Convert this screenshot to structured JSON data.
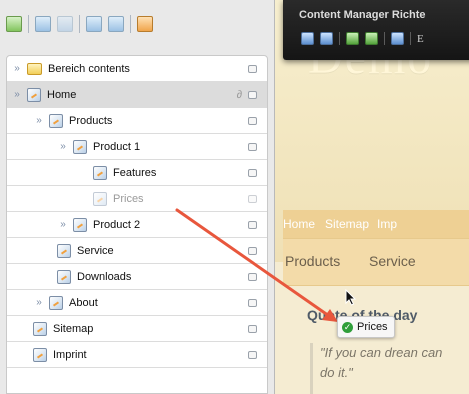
{
  "toolbar": {
    "icons": [
      "new-page-icon",
      "copy-icon",
      "paste-icon",
      "window-icon",
      "panels-icon",
      "export-icon"
    ]
  },
  "tree": {
    "items": [
      {
        "label": "Bereich contents",
        "expanded": true
      },
      {
        "label": "Home",
        "expanded": true
      },
      {
        "label": "Products",
        "expanded": true
      },
      {
        "label": "Product 1",
        "expanded": true
      },
      {
        "label": "Features"
      },
      {
        "label": "Prices",
        "dragging": true
      },
      {
        "label": "Product 2",
        "collapsed": true
      },
      {
        "label": "Service"
      },
      {
        "label": "Downloads"
      },
      {
        "label": "About",
        "collapsed": true
      },
      {
        "label": "Sitemap"
      },
      {
        "label": "Imprint"
      }
    ]
  },
  "cms": {
    "title": "Content Manager Richte",
    "letter": "E"
  },
  "site": {
    "big_title": "Demo",
    "nav_top": [
      "Home",
      "Sitemap",
      "Imp"
    ],
    "nav_main": [
      "Products",
      "Service"
    ],
    "quote_heading": "Quote of the day",
    "quote_text": "\"If you can drean can do it.\""
  },
  "drag": {
    "chip_label": "Prices"
  },
  "colors": {
    "accent_green": "#2f9e3a",
    "arrow": "#e8573d",
    "nav_bar": "#eed094"
  }
}
